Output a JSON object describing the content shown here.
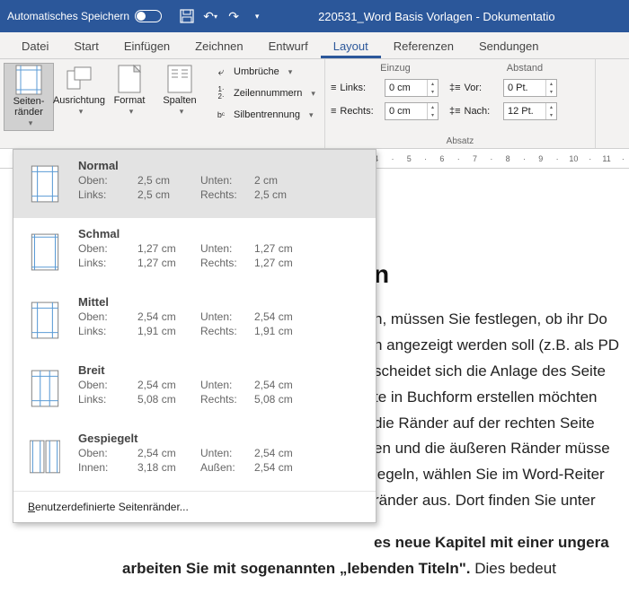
{
  "titlebar": {
    "autosave_label": "Automatisches Speichern",
    "document_title": "220531_Word Basis Vorlagen - Dokumentatio"
  },
  "tabs": {
    "items": [
      "Datei",
      "Start",
      "Einfügen",
      "Zeichnen",
      "Entwurf",
      "Layout",
      "Referenzen",
      "Sendungen"
    ],
    "active_index": 5
  },
  "ribbon": {
    "page_setup": {
      "margins": "Seiten-\nränder",
      "orientation": "Ausrichtung",
      "size": "Format",
      "columns": "Spalten",
      "breaks": "Umbrüche",
      "line_numbers": "Zeilennummern",
      "hyphenation": "Silbentrennung"
    },
    "paragraph": {
      "indent_header": "Einzug",
      "spacing_header": "Abstand",
      "left_label": "Links:",
      "right_label": "Rechts:",
      "before_label": "Vor:",
      "after_label": "Nach:",
      "left_value": "0 cm",
      "right_value": "0 cm",
      "before_value": "0 Pt.",
      "after_value": "12 Pt.",
      "group_label": "Absatz"
    }
  },
  "dropdown": {
    "presets": [
      {
        "name": "Normal",
        "rows": [
          {
            "l1": "Oben:",
            "v1": "2,5 cm",
            "l2": "Unten:",
            "v2": "2 cm"
          },
          {
            "l1": "Links:",
            "v1": "2,5 cm",
            "l2": "Rechts:",
            "v2": "2,5 cm"
          }
        ],
        "highlight": true
      },
      {
        "name": "Schmal",
        "rows": [
          {
            "l1": "Oben:",
            "v1": "1,27 cm",
            "l2": "Unten:",
            "v2": "1,27 cm"
          },
          {
            "l1": "Links:",
            "v1": "1,27 cm",
            "l2": "Rechts:",
            "v2": "1,27 cm"
          }
        ]
      },
      {
        "name": "Mittel",
        "rows": [
          {
            "l1": "Oben:",
            "v1": "2,54 cm",
            "l2": "Unten:",
            "v2": "2,54 cm"
          },
          {
            "l1": "Links:",
            "v1": "1,91 cm",
            "l2": "Rechts:",
            "v2": "1,91 cm"
          }
        ]
      },
      {
        "name": "Breit",
        "rows": [
          {
            "l1": "Oben:",
            "v1": "2,54 cm",
            "l2": "Unten:",
            "v2": "2,54 cm"
          },
          {
            "l1": "Links:",
            "v1": "5,08 cm",
            "l2": "Rechts:",
            "v2": "5,08 cm"
          }
        ]
      },
      {
        "name": "Gespiegelt",
        "rows": [
          {
            "l1": "Oben:",
            "v1": "2,54 cm",
            "l2": "Unten:",
            "v2": "2,54 cm"
          },
          {
            "l1": "Innen:",
            "v1": "3,18 cm",
            "l2": "Außen:",
            "v2": "2,54 cm"
          }
        ]
      }
    ],
    "custom_label_pre": "B",
    "custom_label_rest": "enutzerdefinierte Seitenränder..."
  },
  "ruler": {
    "marks": [
      "4",
      "·",
      "5",
      "·",
      "6",
      "·",
      "7",
      "·",
      "8",
      "·",
      "9",
      "·",
      "10",
      "·",
      "11",
      "·"
    ]
  },
  "document": {
    "heading_suffix": "n",
    "body_lines": [
      "n, müssen Sie festlegen, ob ihr Do",
      "n angezeigt werden soll (z.B. als PD",
      "scheidet sich die Anlage des Seite",
      "te in Buchform erstellen möchten",
      " die Ränder auf der rechten Seite ",
      "en und die äußeren Ränder müsse",
      "iegeln, wählen Sie im Word-Reiter",
      "ränder aus. Dort finden Sie unter "
    ],
    "bold_line_1": "es neue Kapitel mit einer ungera",
    "bold_prefix": "arbeiten Sie mit sogenannten „lebenden Titeln\".",
    "bold_suffix": " Dies bedeut"
  }
}
